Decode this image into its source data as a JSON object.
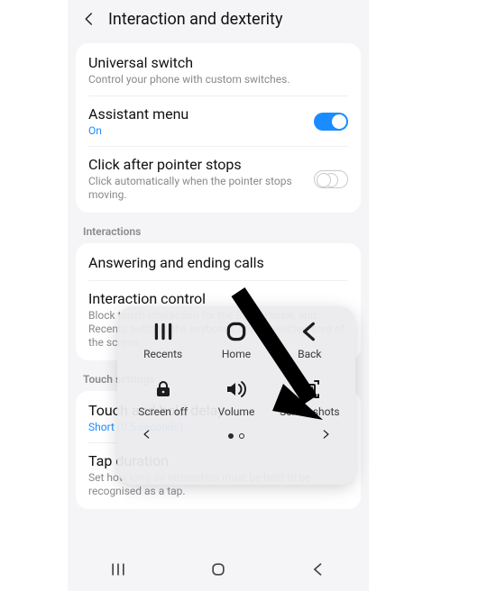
{
  "header": {
    "title": "Interaction and dexterity"
  },
  "group1": {
    "universal": {
      "title": "Universal switch",
      "sub": "Control your phone with custom switches."
    },
    "assistant": {
      "title": "Assistant menu",
      "state": "On",
      "toggle": true
    },
    "clickafter": {
      "title": "Click after pointer stops",
      "sub": "Click automatically when the pointer stops moving.",
      "toggle": false
    }
  },
  "sections": {
    "interactions": "Interactions",
    "touch": "Touch settings"
  },
  "group2": {
    "answering": {
      "title": "Answering and ending calls"
    },
    "interactionControl": {
      "title": "Interaction control",
      "sub": "Block touch interaction for the Back, Home, and Recents buttons, the keyboard, and a selected area of the screen."
    }
  },
  "group3": {
    "touchHold": {
      "title": "Touch and hold delay",
      "state": "Short (0.5 seconds)"
    },
    "tapDuration": {
      "title": "Tap duration",
      "sub": "Set how long an interaction must be held to be recognised as a tap."
    }
  },
  "assist": {
    "items": [
      {
        "id": "recents",
        "label": "Recents"
      },
      {
        "id": "home",
        "label": "Home"
      },
      {
        "id": "back",
        "label": "Back"
      },
      {
        "id": "screenoff",
        "label": "Screen off"
      },
      {
        "id": "volume",
        "label": "Volume"
      },
      {
        "id": "screenshots",
        "label": "Screenshots"
      }
    ]
  }
}
